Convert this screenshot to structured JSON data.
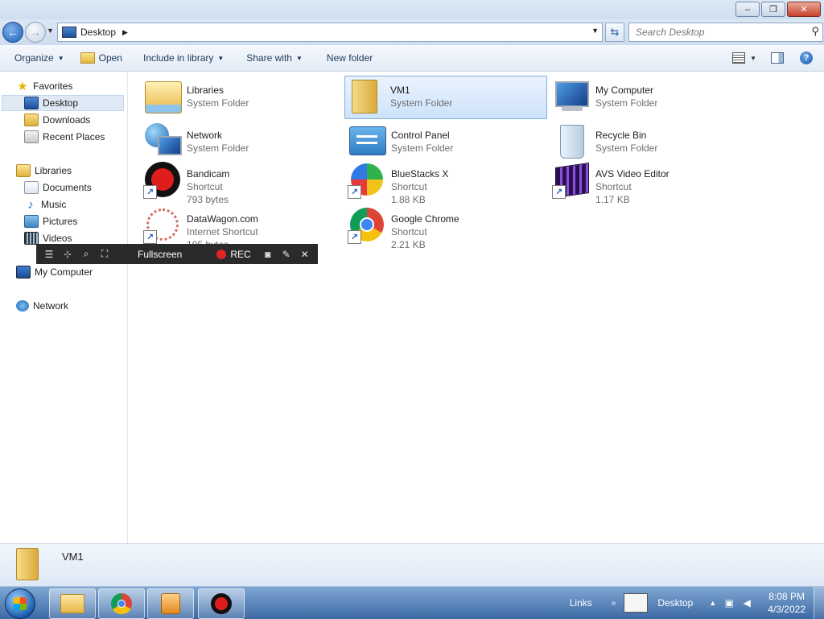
{
  "window": {
    "minimize_glyph": "–",
    "maximize_glyph": "❐",
    "close_glyph": "✕"
  },
  "address": {
    "location": "Desktop",
    "search_placeholder": "Search Desktop"
  },
  "toolbar": {
    "organize": "Organize",
    "open": "Open",
    "include_in_library": "Include in library",
    "share_with": "Share with",
    "new_folder": "New folder",
    "help_glyph": "?"
  },
  "nav": {
    "favorites": "Favorites",
    "desktop": "Desktop",
    "downloads": "Downloads",
    "recent_places": "Recent Places",
    "libraries": "Libraries",
    "documents": "Documents",
    "music": "Music",
    "pictures": "Pictures",
    "videos": "Videos",
    "my_computer": "My Computer",
    "network": "Network"
  },
  "items": [
    {
      "name": "Libraries",
      "type": "System Folder",
      "size": ""
    },
    {
      "name": "VM1",
      "type": "System Folder",
      "size": ""
    },
    {
      "name": "My Computer",
      "type": "System Folder",
      "size": ""
    },
    {
      "name": "Network",
      "type": "System Folder",
      "size": ""
    },
    {
      "name": "Control Panel",
      "type": "System Folder",
      "size": ""
    },
    {
      "name": "Recycle Bin",
      "type": "System Folder",
      "size": ""
    },
    {
      "name": "Bandicam",
      "type": "Shortcut",
      "size": "793 bytes"
    },
    {
      "name": "BlueStacks X",
      "type": "Shortcut",
      "size": "1.88 KB"
    },
    {
      "name": "AVS Video Editor",
      "type": "Shortcut",
      "size": "1.17 KB"
    },
    {
      "name": "DataWagon.com",
      "type": "Internet Shortcut",
      "size": "105 bytes"
    },
    {
      "name": "Google Chrome",
      "type": "Shortcut",
      "size": "2.21 KB"
    }
  ],
  "bandicam_bar": {
    "mode": "Fullscreen",
    "rec": "REC"
  },
  "details": {
    "selected_name": "VM1"
  },
  "taskbar": {
    "links": "Links",
    "desktop": "Desktop",
    "time": "8:08 PM",
    "date": "4/3/2022"
  }
}
